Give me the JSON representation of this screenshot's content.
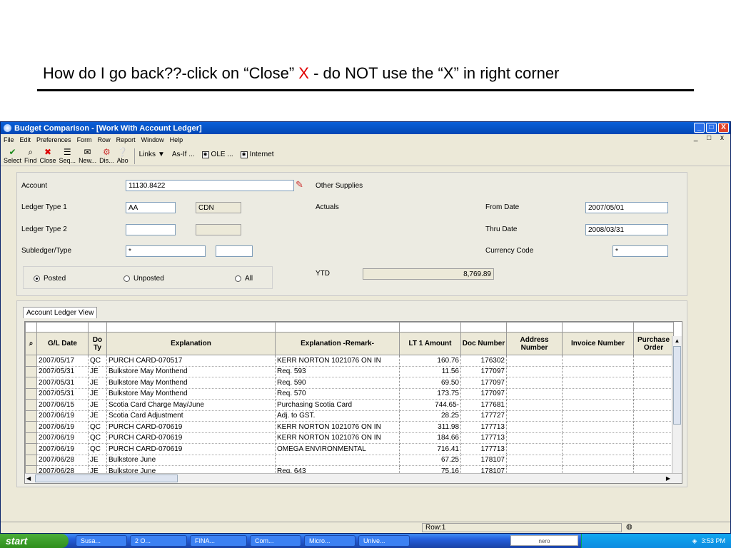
{
  "slide": {
    "title_part1": "How do I go back??-click on “Close” ",
    "title_x": "X",
    "title_part2": " - do NOT use the “X” in right corner"
  },
  "window": {
    "title": "Budget Comparison - [Work With Account Ledger]",
    "controls": [
      "_",
      "□",
      "X"
    ]
  },
  "menu": {
    "items": [
      "File",
      "Edit",
      "Preferences",
      "Form",
      "Row",
      "Report",
      "Window",
      "Help"
    ],
    "mdi_controls": "_ □ x"
  },
  "toolbar": {
    "buttons": [
      {
        "label": "Select",
        "icon": "✔"
      },
      {
        "label": "Find",
        "icon": "⌕"
      },
      {
        "label": "Close",
        "icon": "✖"
      },
      {
        "label": "Seq...",
        "icon": "☰"
      },
      {
        "label": "New...",
        "icon": "✉"
      },
      {
        "label": "Dis...",
        "icon": "⚙"
      },
      {
        "label": "Abo",
        "icon": "❔"
      }
    ],
    "links": [
      "Links",
      "As-If ...",
      "OLE ...",
      "Internet"
    ]
  },
  "form": {
    "account_label": "Account",
    "account_value": "11130.8422",
    "account_desc": "Other Supplies",
    "ledger_type1_label": "Ledger Type 1",
    "ledger_type1_value": "AA",
    "ledger_type1_currency": "CDN",
    "ledger_type1_desc": "Actuals",
    "ledger_type2_label": "Ledger Type 2",
    "ledger_type2_value": "",
    "subledger_label": "Subledger/Type",
    "subledger_value": "*",
    "from_date_label": "From Date",
    "from_date_value": "2007/05/01",
    "thru_date_label": "Thru Date",
    "thru_date_value": "2008/03/31",
    "currency_code_label": "Currency Code",
    "currency_code_value": "*",
    "radio_posted": "Posted",
    "radio_unposted": "Unposted",
    "radio_all": "All",
    "ytd_label": "YTD",
    "ytd_value": "8,769.89"
  },
  "grid": {
    "tab_label": "Account Ledger View",
    "columns": [
      "G/L Date",
      "Do Ty",
      "Explanation",
      "Explanation -Remark-",
      "LT 1 Amount",
      "Doc Number",
      "Address Number",
      "Invoice Number",
      "Purchase Order"
    ],
    "rows": [
      [
        "2007/05/17",
        "QC",
        "PURCH CARD-070517",
        "KERR NORTON 1021076 ON IN",
        "160.76",
        "176302",
        "",
        "",
        ""
      ],
      [
        "2007/05/31",
        "JE",
        "Bulkstore May Monthend",
        "Req. 593",
        "11.56",
        "177097",
        "",
        "",
        ""
      ],
      [
        "2007/05/31",
        "JE",
        "Bulkstore May Monthend",
        "Req. 590",
        "69.50",
        "177097",
        "",
        "",
        ""
      ],
      [
        "2007/05/31",
        "JE",
        "Bulkstore May Monthend",
        "Req. 570",
        "173.75",
        "177097",
        "",
        "",
        ""
      ],
      [
        "2007/06/15",
        "JE",
        "Scotia Card Charge May/June",
        "Purchasing Scotia Card",
        "744.65-",
        "177681",
        "",
        "",
        ""
      ],
      [
        "2007/06/19",
        "JE",
        "Scotia Card Adjustment",
        "Adj. to GST.",
        "28.25",
        "177727",
        "",
        "",
        ""
      ],
      [
        "2007/06/19",
        "QC",
        "PURCH CARD-070619",
        "KERR NORTON 1021076 ON IN",
        "311.98",
        "177713",
        "",
        "",
        ""
      ],
      [
        "2007/06/19",
        "QC",
        "PURCH CARD-070619",
        "KERR NORTON 1021076 ON IN",
        "184.66",
        "177713",
        "",
        "",
        ""
      ],
      [
        "2007/06/19",
        "QC",
        "PURCH CARD-070619",
        "OMEGA ENVIRONMENTAL",
        "716.41",
        "177713",
        "",
        "",
        ""
      ],
      [
        "2007/06/28",
        "JE",
        "Bulkstore June",
        "",
        "67.25",
        "178107",
        "",
        "",
        ""
      ],
      [
        "2007/06/28",
        "JE",
        "Bulkstore June",
        "Req. 643",
        "75.16",
        "178107",
        "",
        "",
        ""
      ]
    ]
  },
  "status": {
    "row": "Row:1"
  },
  "taskbar": {
    "start": "start",
    "tasks": [
      "Susa...",
      "2 O...",
      "FINA...",
      "Com...",
      "Micro...",
      "Unive..."
    ],
    "nero": "nero",
    "clock": "3:53 PM"
  }
}
